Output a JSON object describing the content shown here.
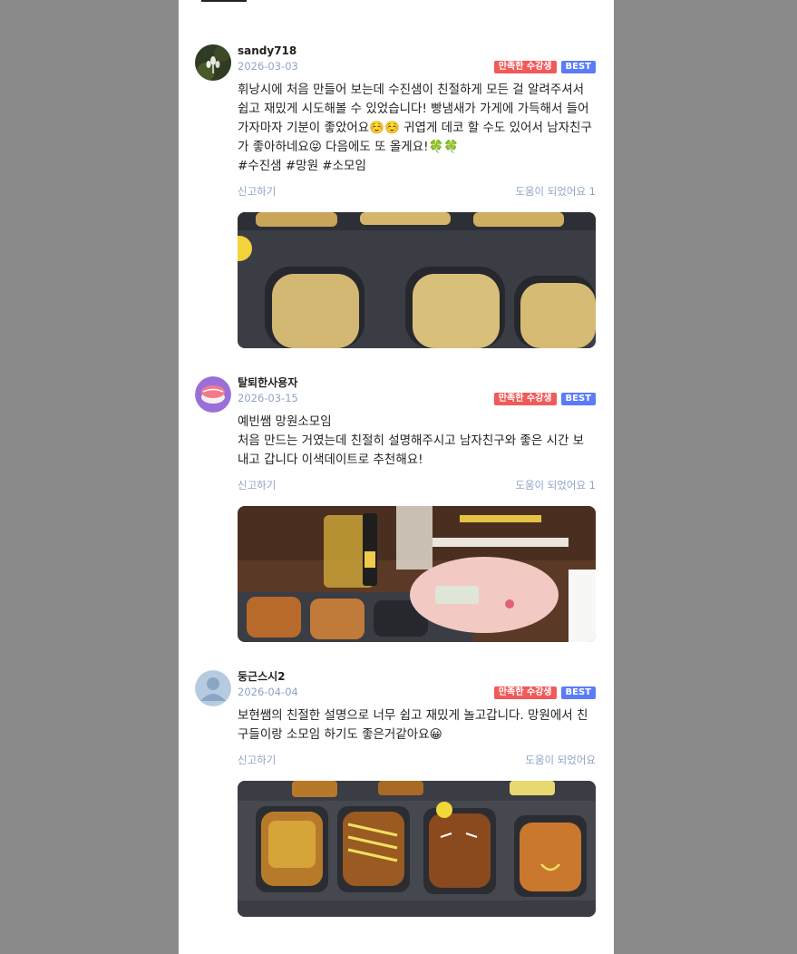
{
  "reviews": [
    {
      "username": "sandy718",
      "date": "2026-03-03",
      "badge_satisfied": "만족한 수강생",
      "badge_best": "BEST",
      "text": "휘낭시에 처음 만들어 보는데 수진샘이 친절하게 모든 걸 알려주셔서\n쉽고 재밌게 시도해볼 수 있었습니다! 빵냄새가 가게에 가득해서 들어\n가자마자 기분이 좋았어요☺️☺️ 귀엽게 데코 할 수도 있어서 남자친구\n가 좋아하네요😝 다음에도 또 올게요!🍀🍀\n#수진샘 #망원 #소모임",
      "report": "신고하기",
      "helpful": "도움이 되었어요 1",
      "avatar_icon": "mushroom-photo-avatar",
      "photo_icon": "financier-batter-tray-photo"
    },
    {
      "username": "탈퇴한사용자",
      "date": "2026-03-15",
      "badge_satisfied": "만족한 수강생",
      "badge_best": "BEST",
      "text": "예빈쌤 망원소모임\n처음 만드는 거였는데 친절히 설명해주시고 남자친구와 좋은 시간 보\n내고 갑니다 이색데이트로 추천해요!",
      "report": "신고하기",
      "helpful": "도움이 되었어요 1",
      "avatar_icon": "sushi-avatar",
      "photo_icon": "baking-table-scale-photo"
    },
    {
      "username": "둥근스시2",
      "date": "2026-04-04",
      "badge_satisfied": "만족한 수강생",
      "badge_best": "BEST",
      "text": "보현쌤의 친절한 설명으로 너무 쉽고 재밌게 놀고갑니다. 망원에서 친\n구들이랑 소모임 하기도 좋은거같아요😀",
      "report": "신고하기",
      "helpful": "도움이 되었어요",
      "avatar_icon": "default-user-avatar",
      "photo_icon": "decorated-toast-cakes-photo"
    }
  ],
  "colors": {
    "badge_satisfied": "#f05a5a",
    "badge_best": "#5b7cf5",
    "meta_text": "#8fa3c7"
  }
}
